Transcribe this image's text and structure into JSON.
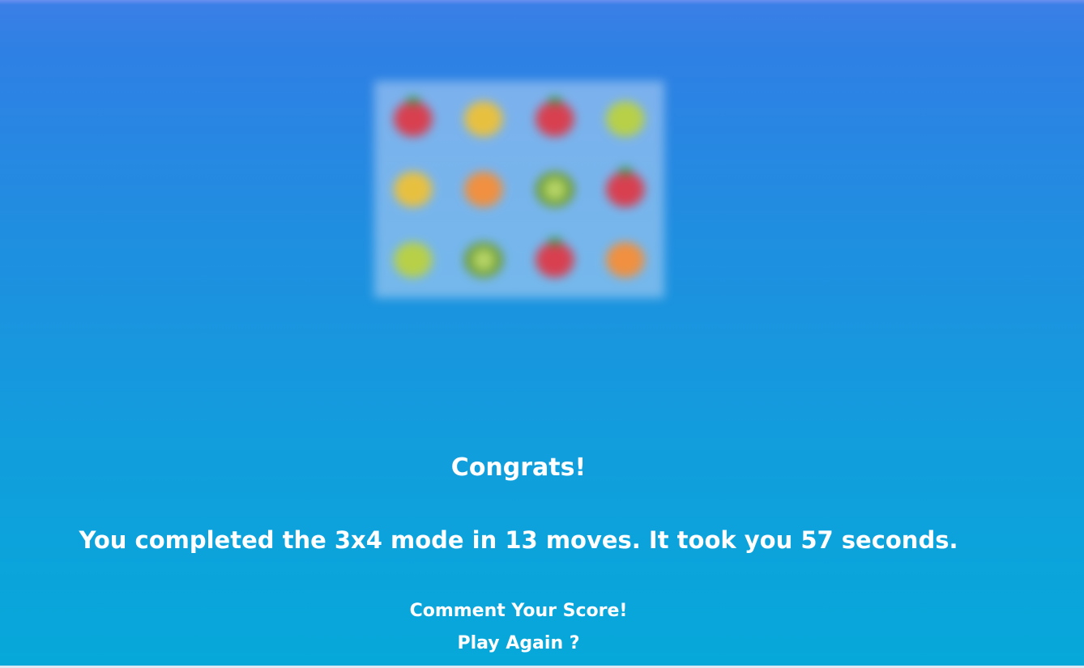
{
  "board": {
    "mode": "3x4",
    "cards": [
      {
        "fruit": "strawberry-icon",
        "color": "#d84050"
      },
      {
        "fruit": "lemon-icon",
        "color": "#e8c040"
      },
      {
        "fruit": "strawberry-icon",
        "color": "#d84050"
      },
      {
        "fruit": "lime-icon",
        "color": "#b8d048"
      },
      {
        "fruit": "lemon-icon",
        "color": "#e8c040"
      },
      {
        "fruit": "orange-icon",
        "color": "#f09040"
      },
      {
        "fruit": "kiwi-icon",
        "color": "#7aa838"
      },
      {
        "fruit": "strawberry-icon",
        "color": "#d84050"
      },
      {
        "fruit": "lime-icon",
        "color": "#b8d048"
      },
      {
        "fruit": "kiwi-icon",
        "color": "#7aa838"
      },
      {
        "fruit": "strawberry-icon",
        "color": "#d84050"
      },
      {
        "fruit": "orange-icon",
        "color": "#f09040"
      }
    ]
  },
  "result": {
    "heading": "Congrats!",
    "summary": "You completed the 3x4 mode in 13 moves. It took you 57 seconds."
  },
  "actions": {
    "comment_label": "Comment Your Score!",
    "play_again_label": "Play Again ?"
  },
  "colors": {
    "background_top": "#2f80e4",
    "background_bottom": "#06a8da",
    "text": "#ffffff"
  }
}
